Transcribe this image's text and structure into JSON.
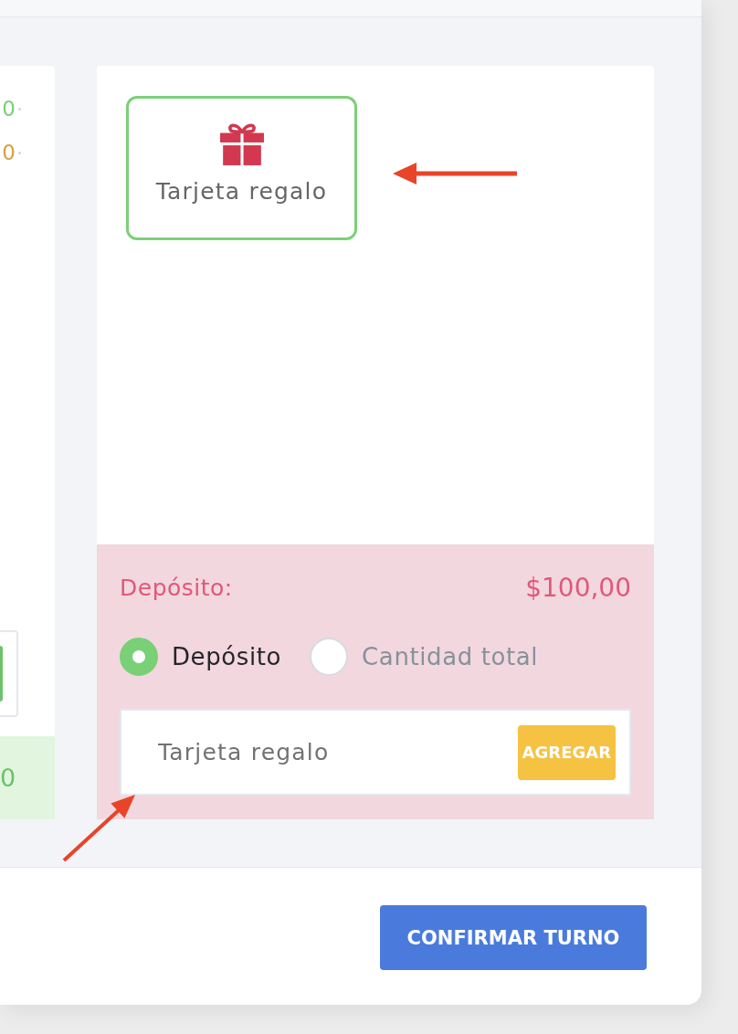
{
  "left_card": {
    "amounts": [
      {
        "text": "0",
        "color": "#7bcf78"
      },
      {
        "text": "0",
        "color": "#d6a13c"
      }
    ],
    "total": "0"
  },
  "payment_methods": [
    {
      "label": "Tarjeta regalo",
      "selected": true
    }
  ],
  "deposit": {
    "label": "Depósito:",
    "amount": "$100,00"
  },
  "payment_options": [
    {
      "label": "Depósito",
      "selected": true
    },
    {
      "label": "Cantidad total",
      "selected": false
    }
  ],
  "gift_card_field": {
    "placeholder": "Tarjeta regalo",
    "button": "AGREGAR"
  },
  "confirm_button": "CONFIRMAR TURNO"
}
